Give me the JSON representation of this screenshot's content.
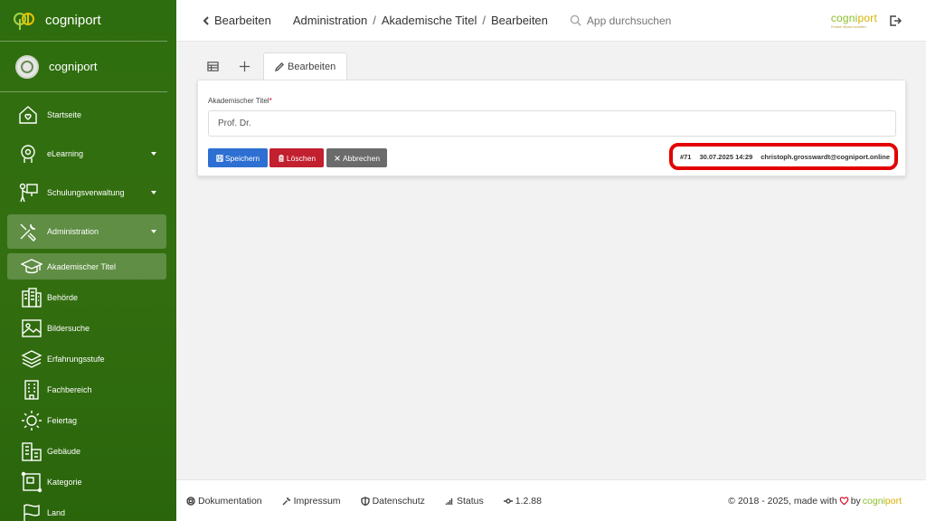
{
  "sidebar": {
    "brand": "cogniport",
    "user": "cogniport",
    "items": [
      {
        "label": "Startseite",
        "icon": "home-heart-icon",
        "expandable": false
      },
      {
        "label": "eLearning",
        "icon": "elearning-icon",
        "expandable": true
      },
      {
        "label": "Schulungsverwaltung",
        "icon": "presentation-icon",
        "expandable": true
      },
      {
        "label": "Administration",
        "icon": "tools-icon",
        "expandable": true
      }
    ],
    "subitems": [
      {
        "label": "Akademischer Titel",
        "icon": "graduation-cap-icon"
      },
      {
        "label": "Behörde",
        "icon": "building-icon"
      },
      {
        "label": "Bildersuche",
        "icon": "image-icon"
      },
      {
        "label": "Erfahrungsstufe",
        "icon": "layers-icon"
      },
      {
        "label": "Fachbereich",
        "icon": "office-icon"
      },
      {
        "label": "Feiertag",
        "icon": "sun-icon"
      },
      {
        "label": "Gebäude",
        "icon": "buildings-icon"
      },
      {
        "label": "Kategorie",
        "icon": "category-icon"
      },
      {
        "label": "Land",
        "icon": "flag-icon"
      }
    ]
  },
  "topbar": {
    "title": "Bearbeiten",
    "breadcrumb": [
      "Administration",
      "Akademische Titel",
      "Bearbeiten"
    ],
    "search_placeholder": "App durchsuchen",
    "logo_a": "cogni",
    "logo_b": "port",
    "logo_tagline": "Positive Wissen schaffen"
  },
  "tabs": {
    "active_label": "Bearbeiten"
  },
  "form": {
    "field_label": "Akademischer Titel",
    "required_mark": "*",
    "field_value": "Prof. Dr.",
    "save_label": "Speichern",
    "delete_label": "Löschen",
    "cancel_label": "Abbrechen",
    "record_id": "#71",
    "timestamp": "30.07.2025 14:29",
    "user_email": "christoph.grosswardt@cogniport.online"
  },
  "footer": {
    "documentation": "Dokumentation",
    "imprint": "Impressum",
    "privacy": "Datenschutz",
    "status": "Status",
    "version": "1.2.88",
    "copyright": "© 2018 - 2025, made with",
    "by": "by",
    "brand_a": "cogni",
    "brand_b": "port"
  },
  "colors": {
    "sidebar_green": "#336f10",
    "save_blue": "#2d6fd2",
    "delete_red": "#c21f2f",
    "cancel_gray": "#6b6b6b",
    "highlight_red": "#e30000"
  }
}
